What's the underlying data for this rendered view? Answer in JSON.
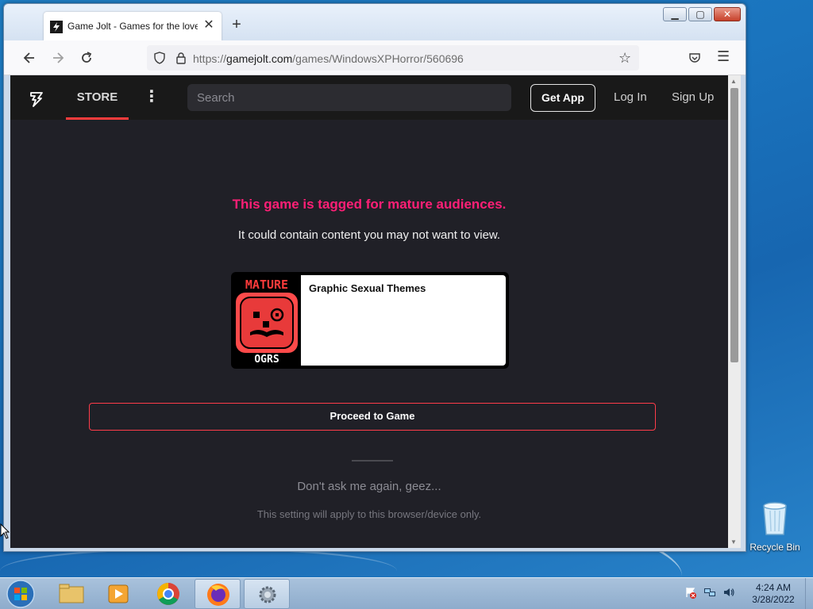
{
  "browser": {
    "tab_title": "Game Jolt - Games for the love of it",
    "new_tab_symbol": "+",
    "tab_close_symbol": "✕",
    "url_domain": "gamejolt.com",
    "url_prefix": "https://",
    "url_path": "/games/WindowsXPHorror/560696",
    "icons": [
      "back-icon",
      "forward-icon",
      "reload-icon",
      "shield-icon",
      "lock-icon",
      "star-icon",
      "pocket-icon",
      "menu-icon"
    ]
  },
  "gamejolt": {
    "nav": {
      "store_label": "STORE",
      "search_placeholder": "Search",
      "get_app_label": "Get App",
      "login_label": "Log In",
      "signup_label": "Sign Up"
    },
    "mature": {
      "title": "This game is tagged for mature audiences.",
      "subtitle": "It could contain content you may not want to view.",
      "rating_top_text": "MATURE",
      "rating_bottom_text": "OGRS",
      "rating_description": "Graphic Sexual Themes",
      "proceed_label": "Proceed to Game",
      "dont_ask_label": "Don't ask me again, geez...",
      "setting_note": "This setting will apply to this browser/device only."
    },
    "colors": {
      "accent_pink": "#ff1f76",
      "accent_red": "#ff3c3c",
      "background": "#202027"
    }
  },
  "desktop": {
    "recycle_bin_label": "Recycle Bin",
    "clock_time": "4:24 AM",
    "clock_date": "3/28/2022"
  }
}
